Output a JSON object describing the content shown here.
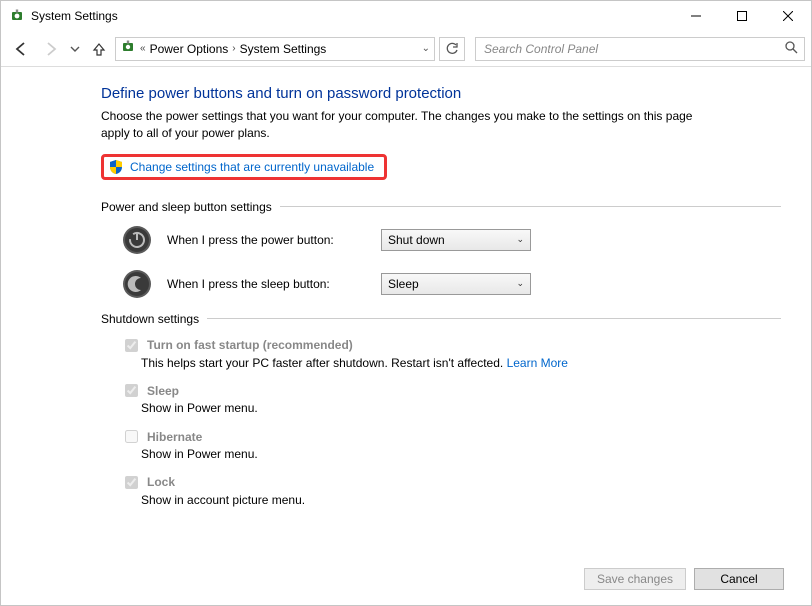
{
  "window": {
    "title": "System Settings"
  },
  "breadcrumb": {
    "segment1": "Power Options",
    "segment2": "System Settings"
  },
  "search": {
    "placeholder": "Search Control Panel"
  },
  "page": {
    "heading": "Define power buttons and turn on password protection",
    "subtext": "Choose the power settings that you want for your computer. The changes you make to the settings on this page apply to all of your power plans.",
    "change_link": "Change settings that are currently unavailable"
  },
  "sections": {
    "buttons_title": "Power and sleep button settings",
    "power_label": "When I press the power button:",
    "power_value": "Shut down",
    "sleep_label": "When I press the sleep button:",
    "sleep_value": "Sleep",
    "shutdown_title": "Shutdown settings"
  },
  "shutdown_settings": {
    "faststart_label": "Turn on fast startup (recommended)",
    "faststart_desc": "This helps start your PC faster after shutdown. Restart isn't affected. ",
    "learn_more": "Learn More",
    "sleep_label": "Sleep",
    "sleep_desc": "Show in Power menu.",
    "hibernate_label": "Hibernate",
    "hibernate_desc": "Show in Power menu.",
    "lock_label": "Lock",
    "lock_desc": "Show in account picture menu."
  },
  "footer": {
    "save": "Save changes",
    "cancel": "Cancel"
  }
}
